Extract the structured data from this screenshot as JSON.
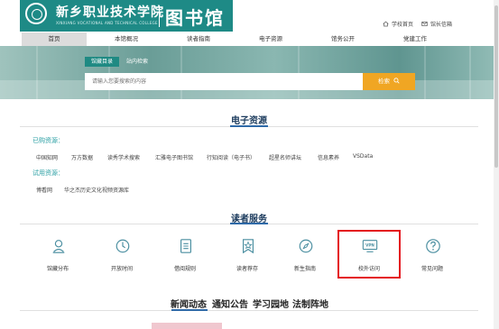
{
  "header": {
    "school_name": "新乡职业技术学院",
    "school_name_en": "XINXIANG VOCATIONAL AND TECHNICAL COLLEGE",
    "library_name": "图书馆",
    "home_link": "学校首页",
    "mailbox_link": "馆长信箱",
    "banner_color": "#1e8a86"
  },
  "nav": {
    "items": [
      "首页",
      "本馆概况",
      "读者指南",
      "电子资源",
      "馆务公开",
      "党建工作"
    ],
    "active_index": 0
  },
  "search": {
    "tabs": [
      "馆藏目录",
      "站内检索"
    ],
    "active_tab": 0,
    "placeholder": "请输入您要搜索的内容",
    "button_label": "检索",
    "button_color": "#f0a623"
  },
  "e_resources": {
    "title": "电子资源",
    "purchased_label": "已购资源：",
    "purchased": [
      "中国知网",
      "万方数据",
      "读秀学术搜索",
      "汇雅电子图书馆",
      "行知阅读（电子书）",
      "超星名师讲坛",
      "信息素养",
      "VSData"
    ],
    "trial_label": "试用资源：",
    "trial": [
      "博看网",
      "华之杰历史文化视频资源库"
    ]
  },
  "reader_services": {
    "title": "读者服务",
    "items": [
      {
        "label": "馆藏分布",
        "icon": "location-person-icon"
      },
      {
        "label": "开放时间",
        "icon": "clock-icon"
      },
      {
        "label": "借阅规则",
        "icon": "document-icon"
      },
      {
        "label": "读者荐存",
        "icon": "bookmark-star-icon"
      },
      {
        "label": "新生指南",
        "icon": "compass-icon"
      },
      {
        "label": "校外访问",
        "icon": "vpn-icon"
      },
      {
        "label": "常见问题",
        "icon": "question-icon"
      }
    ],
    "highlight_color": "#e4141b"
  },
  "news": {
    "tabs": [
      "新闻动态",
      "通知公告",
      "学习园地",
      "法制阵地"
    ],
    "active_tab": 0
  }
}
